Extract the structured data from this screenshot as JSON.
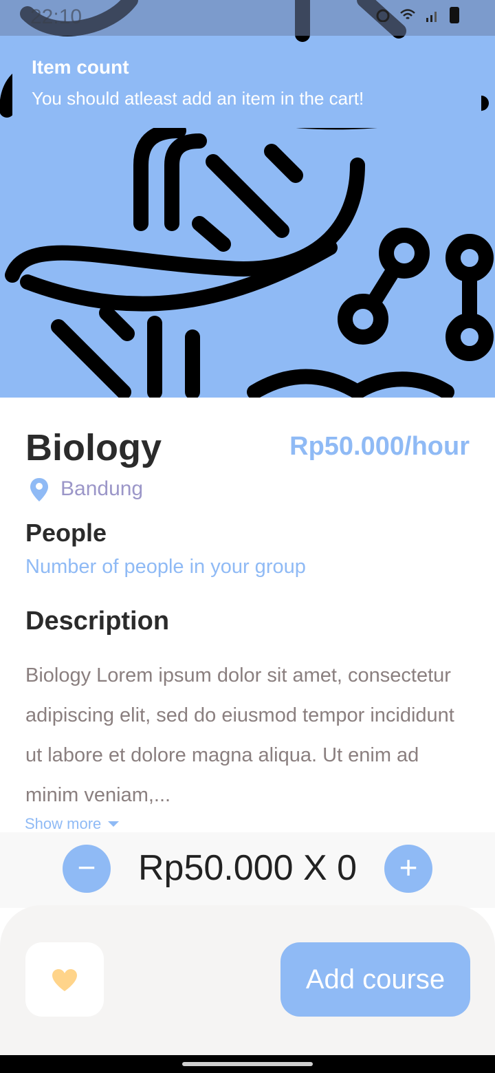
{
  "status_bar": {
    "time": "22:10"
  },
  "toast": {
    "title": "Item count",
    "message": "You should atleast add an item in the cart!"
  },
  "course": {
    "title": "Biology",
    "price": "Rp50.000/hour",
    "location": "Bandung"
  },
  "people": {
    "heading": "People",
    "hint": "Number of people in your group"
  },
  "description": {
    "heading": "Description",
    "text": "Biology Lorem ipsum dolor sit amet, consectetur adipiscing elit, sed do eiusmod tempor incididunt ut labore et dolore magna aliqua. Ut enim ad minim veniam,...",
    "show_more": "Show more"
  },
  "quantity": {
    "minus": "−",
    "plus": "+",
    "summary": "Rp50.000 X 0"
  },
  "actions": {
    "add_course": "Add course"
  },
  "colors": {
    "accent": "#8fbaf5",
    "heart": "#ffd48a",
    "location_text": "#9b96c8",
    "body_text": "#8a7f7f"
  },
  "icons": [
    "location-pin-icon",
    "heart-icon",
    "chevron-down-icon",
    "wifi-icon",
    "signal-icon",
    "battery-icon",
    "alarm-icon"
  ]
}
